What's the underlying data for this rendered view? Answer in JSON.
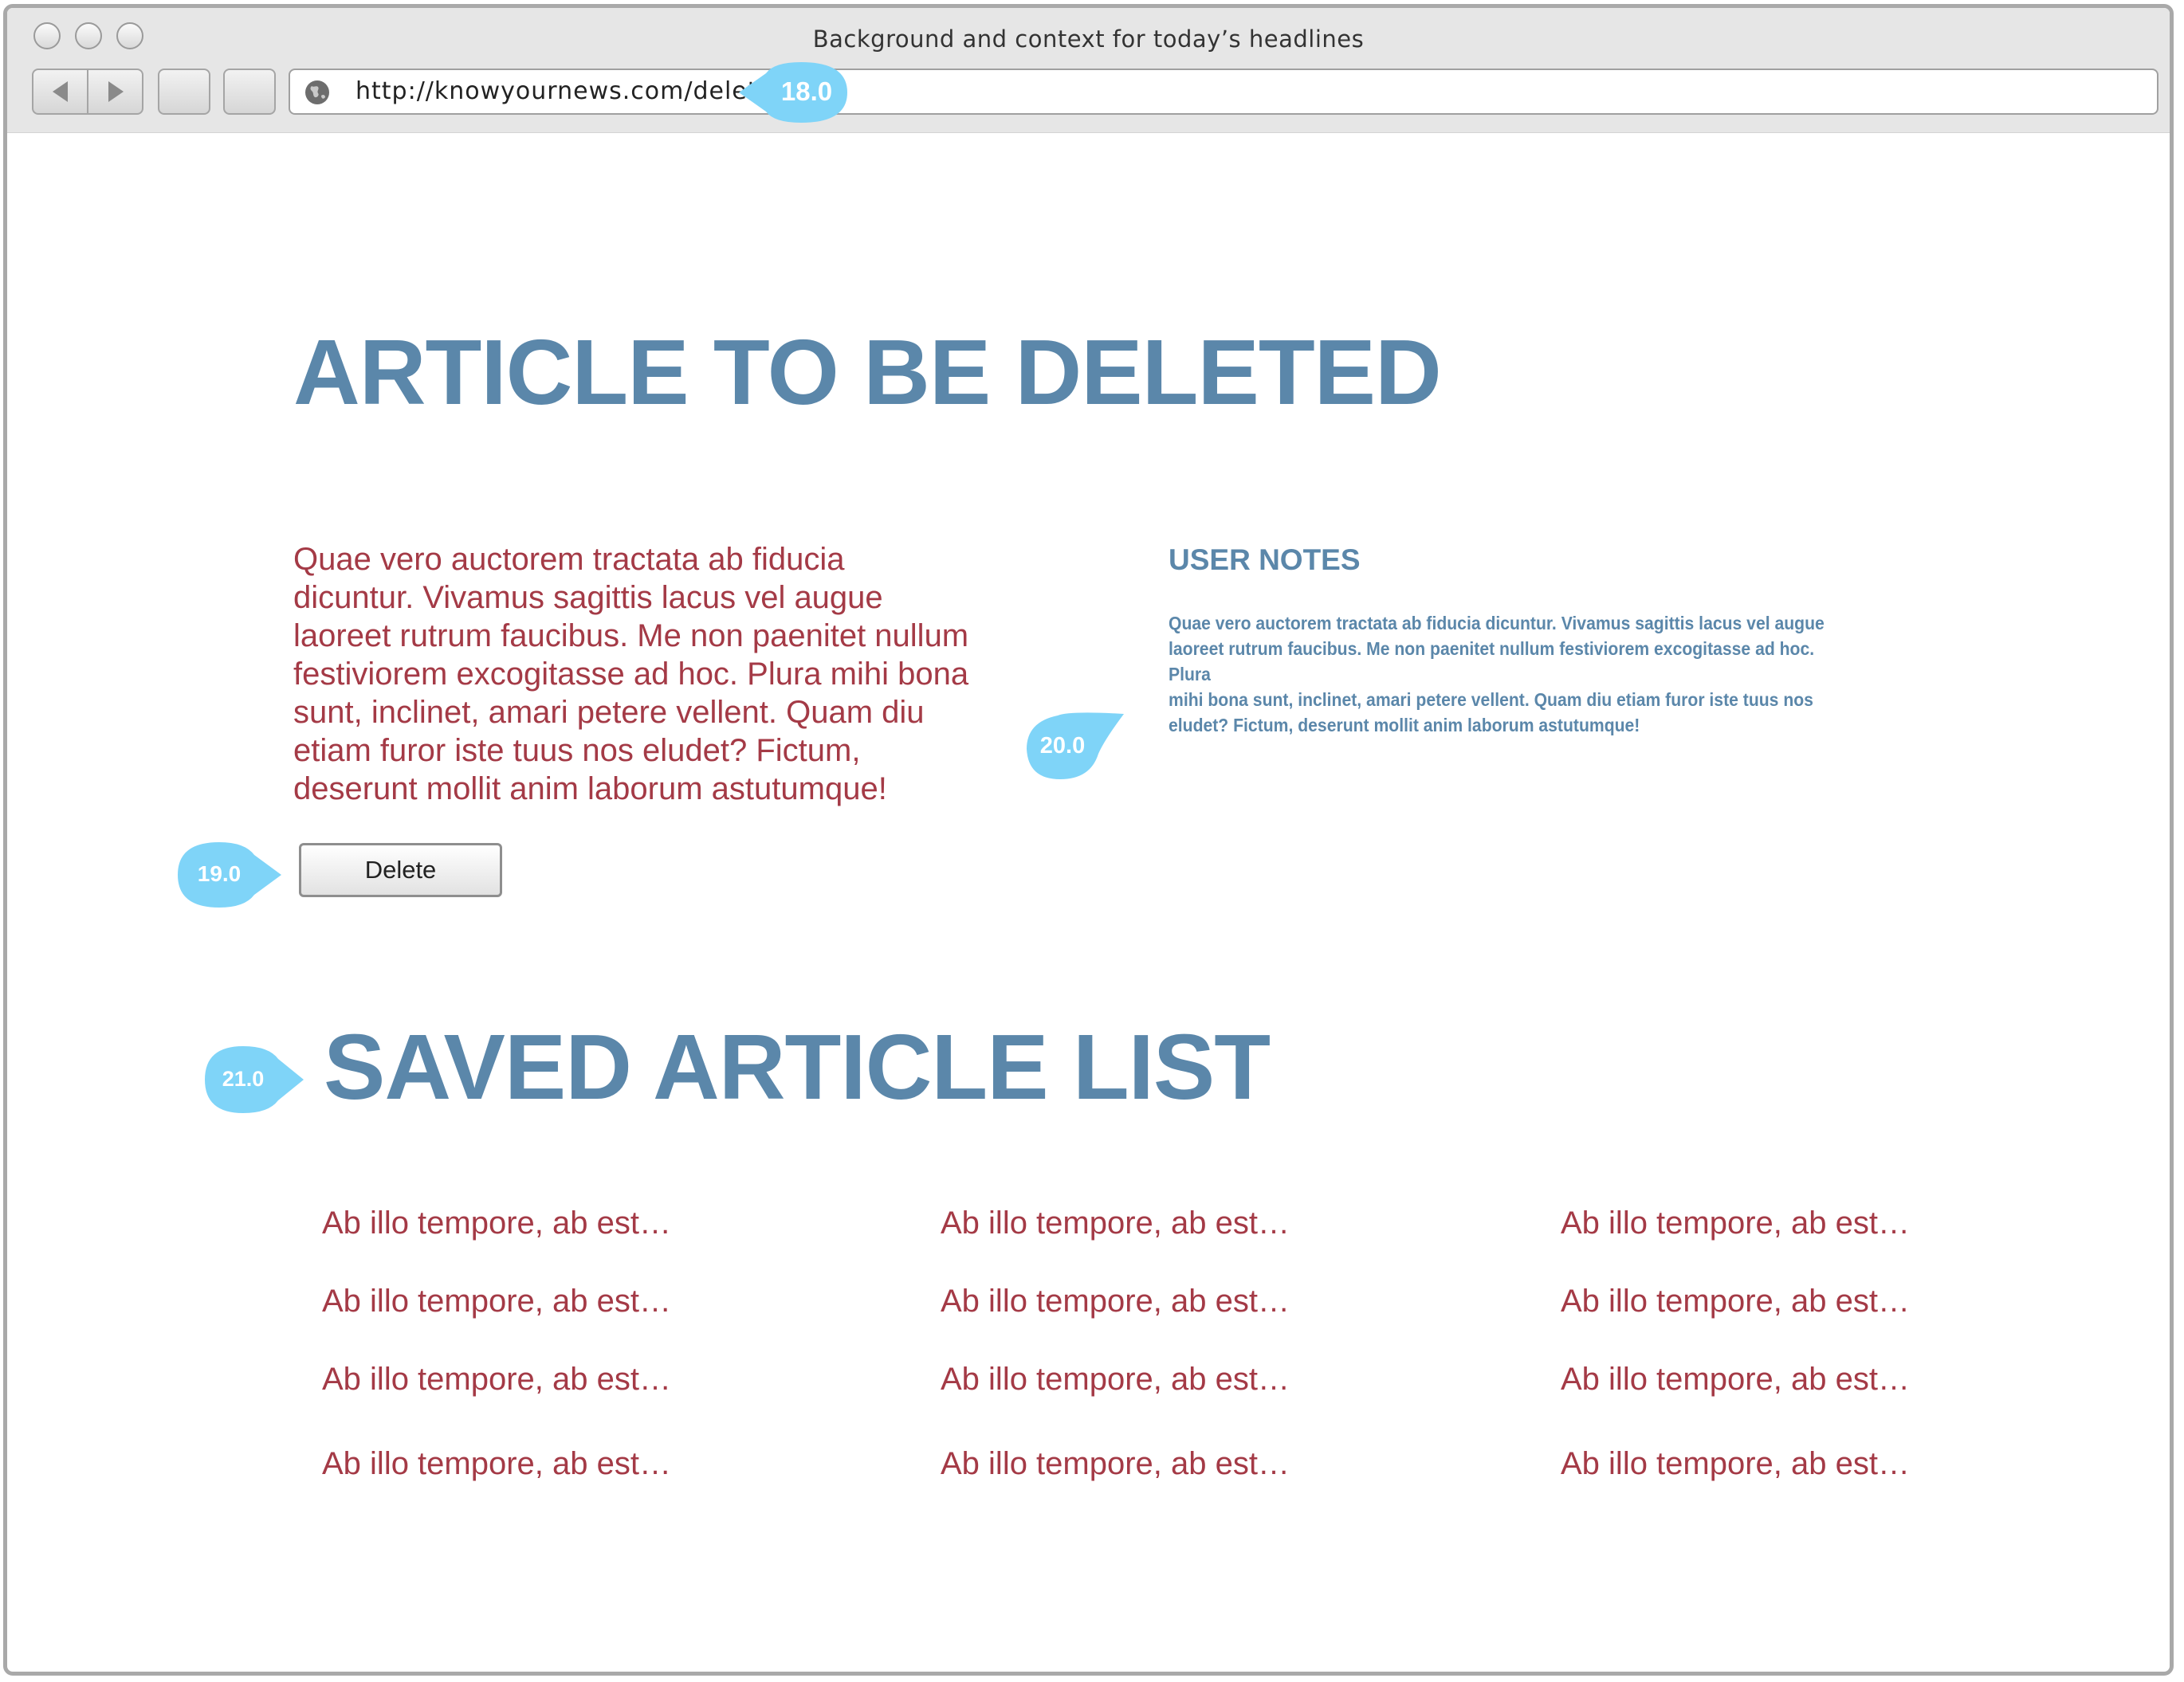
{
  "browser": {
    "title": "Background and context for today’s headlines",
    "url": "http://knowyournews.com/delete"
  },
  "annotations": {
    "url_tag": "18.0",
    "delete_tag": "19.0",
    "notes_tag": "20.0",
    "saved_tag": "21.0",
    "tag_color": "#7fd4f8"
  },
  "article": {
    "heading": "ARTICLE TO BE DELETED",
    "body_lines": [
      "Quae vero auctorem tractata ab fiducia",
      "dicuntur. Vivamus sagittis lacus vel augue",
      "laoreet rutrum faucibus. Me non paenitet nullum",
      "festiviorem excogitasse ad hoc. Plura mihi bona",
      "sunt, inclinet, amari petere vellent. Quam diu",
      "etiam furor iste tuus nos eludet? Fictum,",
      "deserunt mollit anim laborum astutumque!"
    ],
    "delete_label": "Delete"
  },
  "user_notes": {
    "title": "USER NOTES",
    "body_lines": [
      "Quae vero auctorem tractata ab fiducia dicuntur. Vivamus sagittis lacus vel augue",
      "laoreet rutrum faucibus. Me non paenitet nullum festiviorem excogitasse ad hoc. Plura",
      "mihi bona sunt, inclinet, amari petere vellent. Quam diu etiam furor iste tuus nos",
      "eludet? Fictum,  deserunt mollit anim laborum astutumque!"
    ]
  },
  "saved_list": {
    "heading": "SAVED ARTICLE LIST",
    "columns": [
      [
        "Ab illo tempore, ab est…",
        "Ab illo tempore, ab est…",
        "Ab illo tempore, ab est…",
        "Ab illo tempore, ab est…"
      ],
      [
        "Ab illo tempore, ab est…",
        "Ab illo tempore, ab est…",
        "Ab illo tempore, ab est…",
        "Ab illo tempore, ab est…"
      ],
      [
        "Ab illo tempore, ab est…",
        "Ab illo tempore, ab est…",
        "Ab illo tempore, ab est…",
        "Ab illo tempore, ab est…"
      ]
    ]
  },
  "colors": {
    "heading_blue": "#5b87aa",
    "body_red": "#a43a46"
  }
}
